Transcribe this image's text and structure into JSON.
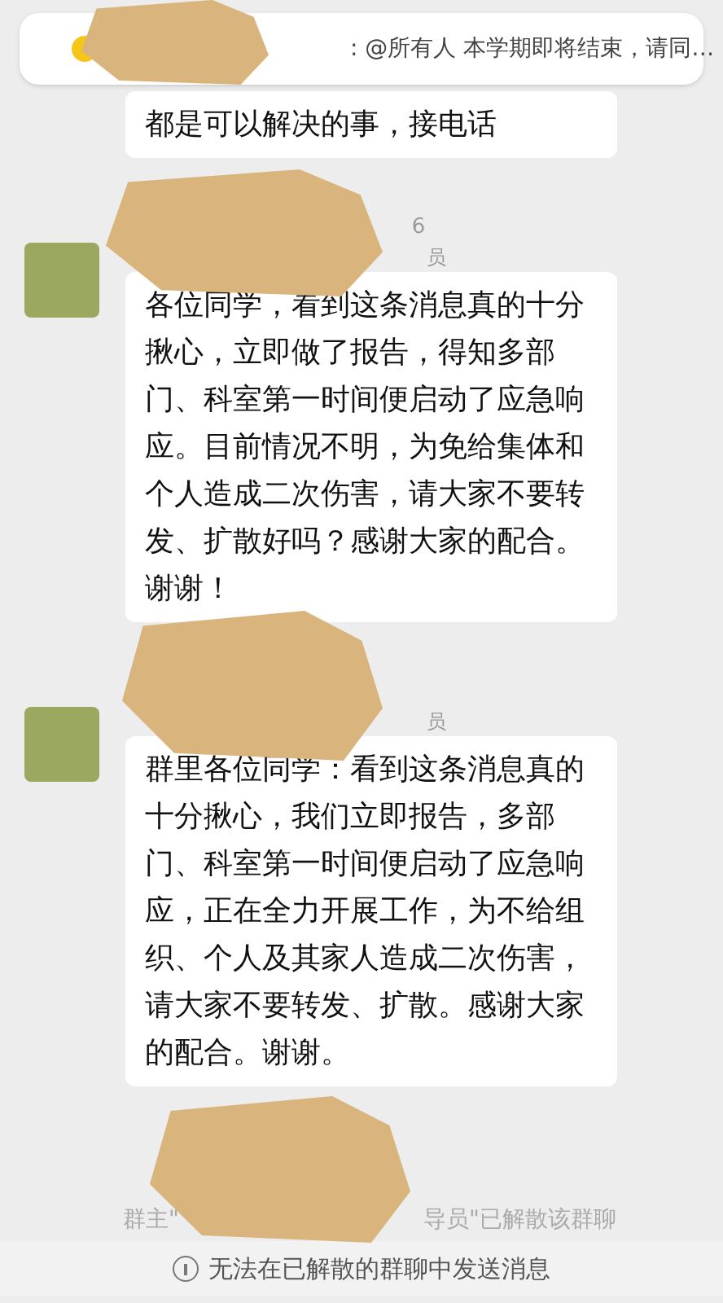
{
  "banner": {
    "text": ": @所有人 本学期即将结束，请同…"
  },
  "messages": [
    {
      "kind": "continued",
      "text": "都是可以解决的事，接电话"
    },
    {
      "kind": "full",
      "time": "6",
      "name": "员",
      "text": "各位同学，看到这条消息真的十分揪心，立即做了报告，得知多部门、科室第一时间便启动了应急响应。目前情况不明，为免给集体和个人造成二次伤害，请大家不要转发、扩散好吗？感谢大家的配合。谢谢！"
    },
    {
      "kind": "full",
      "name": "员",
      "text": "群里各位同学：看到这条消息真的十分揪心，我们立即报告，多部门、科室第一时间便启动了应急响应，正在全力开展工作，为不给组织、个人及其家人造成二次伤害，请大家不要转发、扩散。感谢大家的配合。谢谢。"
    }
  ],
  "system_notice": {
    "before": "群主\"",
    "after": "导员\"已解散该群聊"
  },
  "footer": {
    "text": "无法在已解散的群聊中发送消息"
  }
}
